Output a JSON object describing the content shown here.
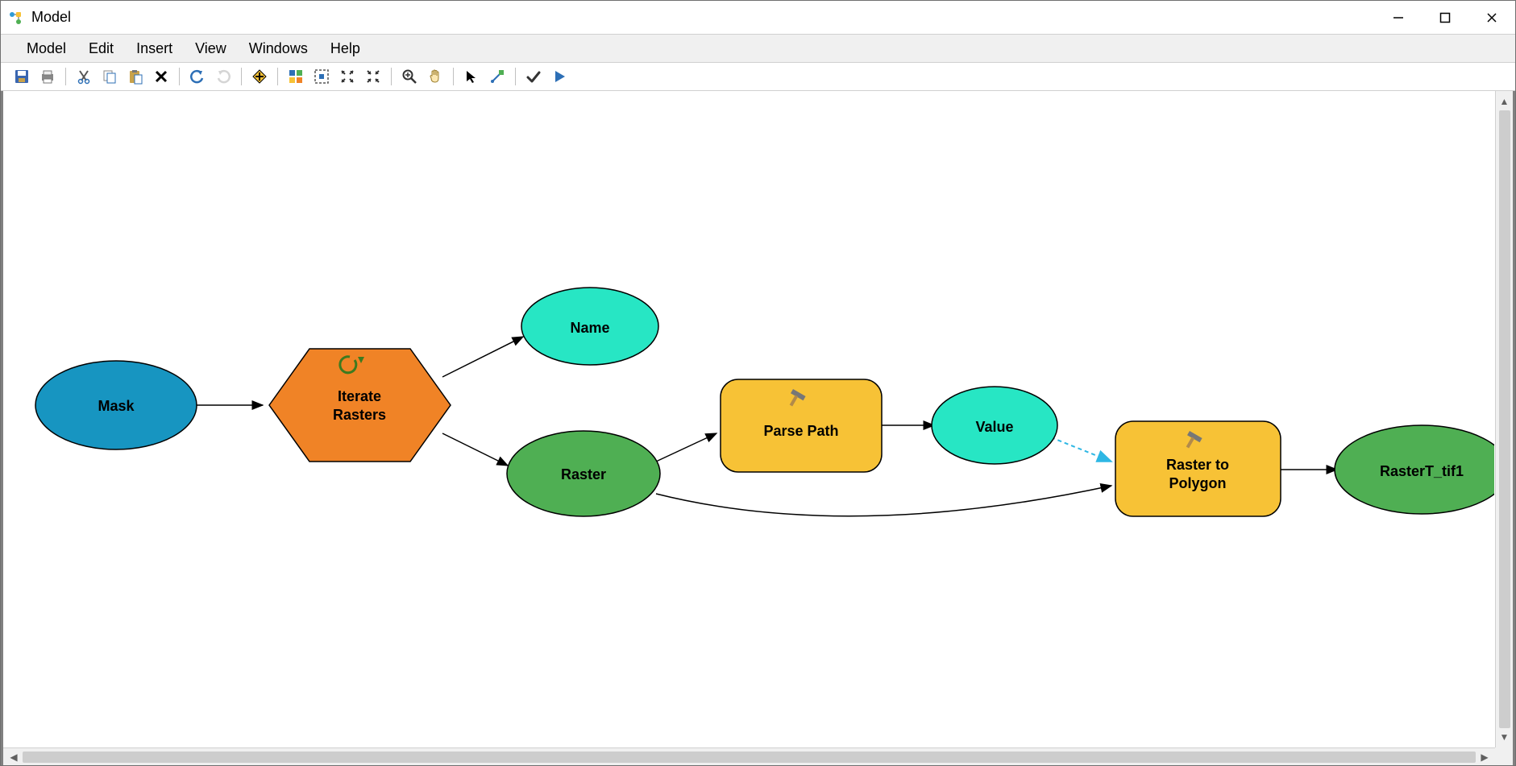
{
  "window": {
    "title": "Model"
  },
  "menubar": {
    "items": [
      "Model",
      "Edit",
      "Insert",
      "View",
      "Windows",
      "Help"
    ]
  },
  "toolbar": {
    "buttons": [
      {
        "name": "save-icon"
      },
      {
        "name": "print-icon"
      },
      {
        "sep": true
      },
      {
        "name": "cut-icon"
      },
      {
        "name": "copy-icon"
      },
      {
        "name": "paste-icon"
      },
      {
        "name": "delete-icon"
      },
      {
        "sep": true
      },
      {
        "name": "undo-icon"
      },
      {
        "name": "redo-icon",
        "disabled": true
      },
      {
        "sep": true
      },
      {
        "name": "add-data-icon"
      },
      {
        "sep": true
      },
      {
        "name": "auto-layout-icon"
      },
      {
        "name": "full-extent-icon"
      },
      {
        "name": "zoom-in-fixed-icon"
      },
      {
        "name": "zoom-out-fixed-icon"
      },
      {
        "sep": true
      },
      {
        "name": "zoom-in-icon"
      },
      {
        "name": "pan-icon"
      },
      {
        "sep": true
      },
      {
        "name": "select-icon"
      },
      {
        "name": "connect-icon"
      },
      {
        "sep": true
      },
      {
        "name": "validate-icon"
      },
      {
        "name": "run-icon"
      }
    ]
  },
  "model": {
    "nodes": {
      "mask": {
        "label": "Mask",
        "type": "data-input",
        "color": "#1795C1"
      },
      "iterate_rasters": {
        "label": "Iterate\nRasters",
        "type": "iterator",
        "color": "#F08326"
      },
      "name": {
        "label": "Name",
        "type": "value",
        "color": "#27E6C4"
      },
      "raster": {
        "label": "Raster",
        "type": "data",
        "color": "#4FAF53"
      },
      "parse_path": {
        "label": "Parse Path",
        "type": "tool",
        "color": "#F7C236"
      },
      "value": {
        "label": "Value",
        "type": "value",
        "color": "#27E6C4"
      },
      "raster_to_poly": {
        "label": "Raster to\nPolygon",
        "type": "tool",
        "color": "#F7C236"
      },
      "output": {
        "label": "RasterT_tif1",
        "type": "data-output",
        "color": "#4FAF53"
      }
    },
    "connectors": [
      {
        "from": "mask",
        "to": "iterate_rasters",
        "style": "solid"
      },
      {
        "from": "iterate_rasters",
        "to": "name",
        "style": "solid"
      },
      {
        "from": "iterate_rasters",
        "to": "raster",
        "style": "solid"
      },
      {
        "from": "raster",
        "to": "parse_path",
        "style": "solid"
      },
      {
        "from": "parse_path",
        "to": "value",
        "style": "solid"
      },
      {
        "from": "value",
        "to": "raster_to_poly",
        "style": "dashed"
      },
      {
        "from": "raster",
        "to": "raster_to_poly",
        "style": "solid"
      },
      {
        "from": "raster_to_poly",
        "to": "output",
        "style": "solid"
      }
    ]
  }
}
